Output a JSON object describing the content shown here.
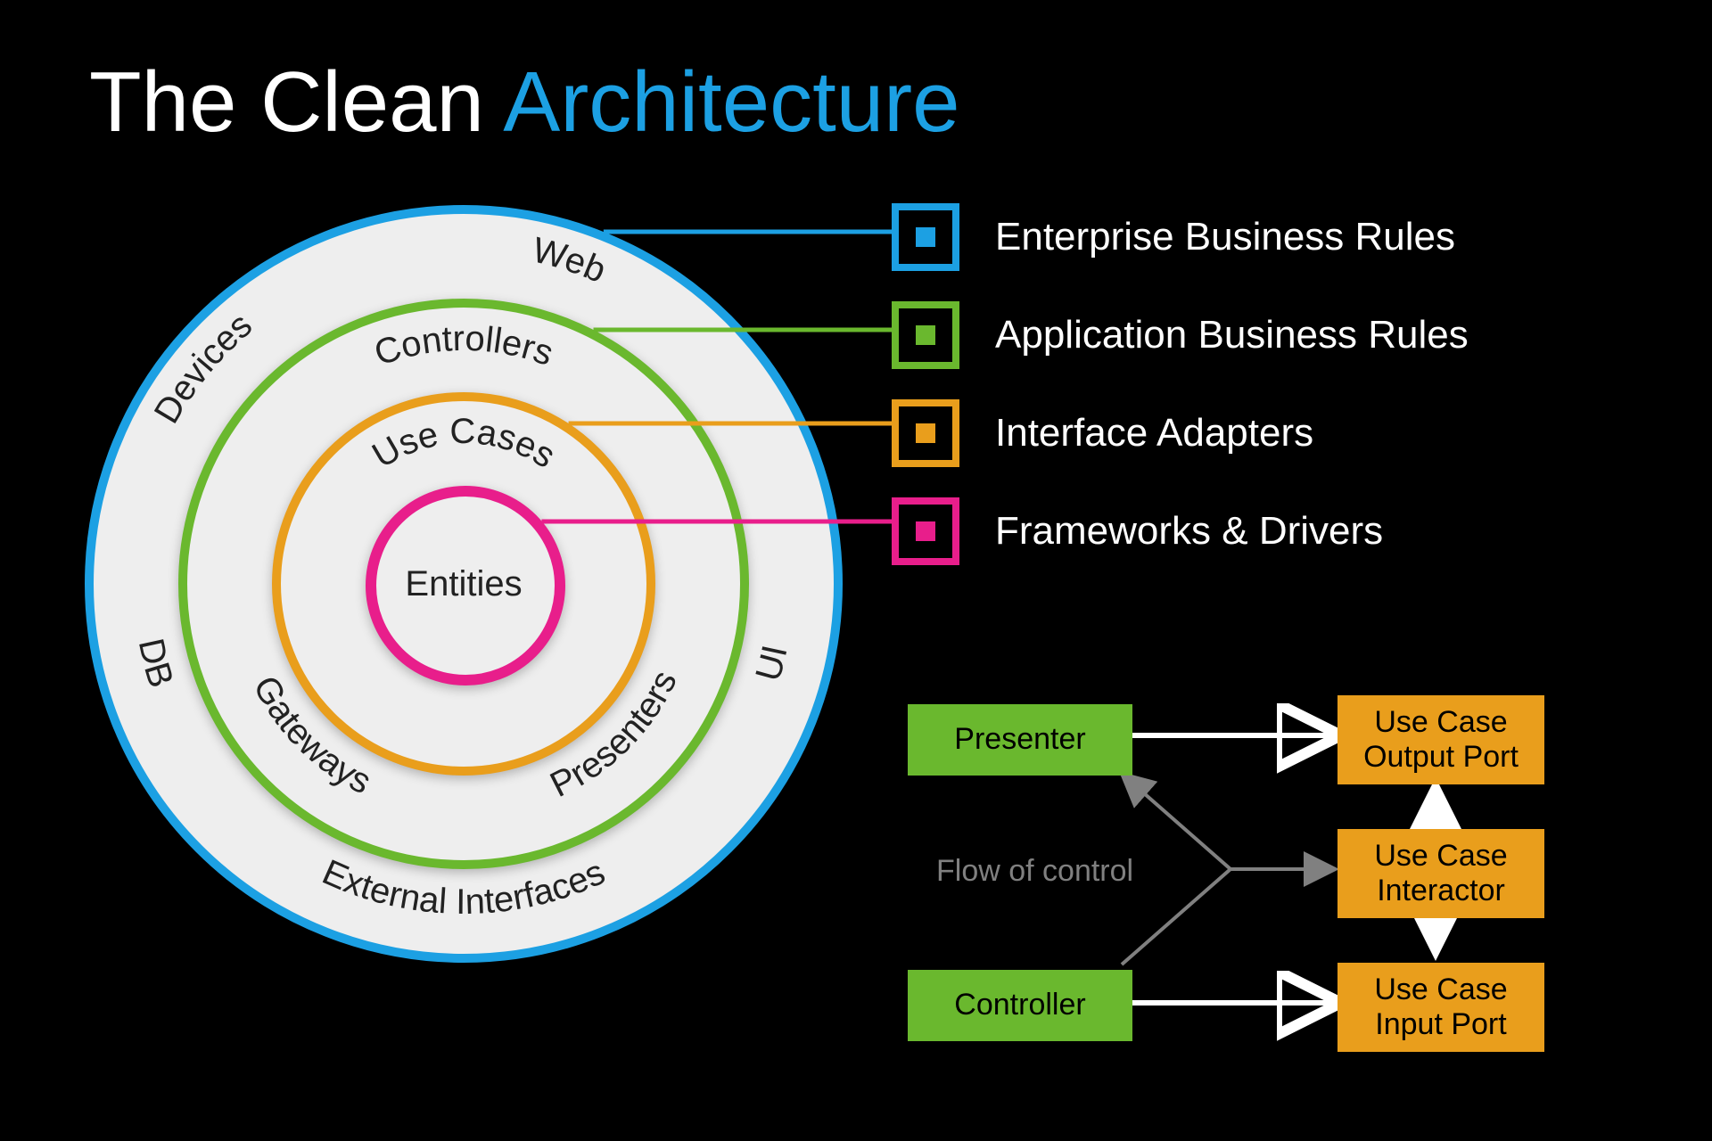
{
  "title": {
    "part1": "The Clean ",
    "part2": "Architecture"
  },
  "colors": {
    "blue": "#1ca0e3",
    "green": "#6ab82e",
    "orange": "#e99e1c",
    "pink": "#e81e8b",
    "white": "#ffffff",
    "gray": "#808080",
    "ringFill": "#eeeeee"
  },
  "rings": {
    "outer": {
      "color": "blue",
      "labels_top": [
        "Devices",
        "Web"
      ],
      "labels_side": [
        "DB",
        "UI"
      ],
      "label_bottom": "External Interfaces"
    },
    "adapter": {
      "color": "green",
      "label_top": "Controllers",
      "labels_bottom": [
        "Gateways",
        "Presenters"
      ]
    },
    "usecase": {
      "color": "orange",
      "label_top": "Use Cases"
    },
    "entity": {
      "color": "pink",
      "label_center": "Entities"
    }
  },
  "legend": [
    {
      "color": "blue",
      "label": "Enterprise Business Rules"
    },
    {
      "color": "green",
      "label": "Application Business Rules"
    },
    {
      "color": "orange",
      "label": "Interface Adapters"
    },
    {
      "color": "pink",
      "label": "Frameworks & Drivers"
    }
  ],
  "legend_connect_y": [
    260,
    370,
    475,
    585
  ],
  "flow": {
    "label": "Flow of control",
    "boxes": {
      "presenter": {
        "text": "Presenter",
        "color": "green"
      },
      "controller": {
        "text": "Controller",
        "color": "green"
      },
      "outputPort": {
        "text": "Use Case\nOutput Port",
        "color": "orange"
      },
      "interactor": {
        "text": "Use Case\nInteractor",
        "color": "orange"
      },
      "inputPort": {
        "text": "Use Case\nInput Port",
        "color": "orange"
      }
    }
  }
}
